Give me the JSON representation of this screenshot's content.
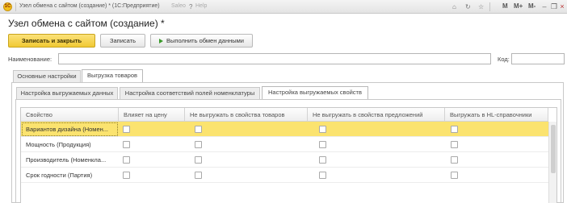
{
  "window": {
    "app_icon": "1С",
    "title": "Узел обмена с сайтом (создание) * (1С:Предприятие)",
    "grey_text": "Saleo",
    "help_text": "Help",
    "m_buttons": [
      "M",
      "M+",
      "M-"
    ],
    "icons": [
      "home-icon",
      "refresh-icon",
      "star-icon",
      "minimize-icon",
      "restore-icon",
      "close-icon"
    ]
  },
  "form": {
    "title": "Узел обмена с сайтом (создание) *"
  },
  "toolbar": {
    "save_close": "Записать и закрыть",
    "save": "Записать",
    "run_exchange": "Выполнить обмен данными"
  },
  "fields": {
    "name_label": "Наименование:",
    "name_value": "",
    "code_label": "Код:",
    "code_value": ""
  },
  "tabs": [
    {
      "label": "Основные настройки",
      "active": false
    },
    {
      "label": "Выгрузка товаров",
      "active": true
    }
  ],
  "subtabs": [
    {
      "label": "Настройка выгружаемых данных",
      "active": false
    },
    {
      "label": "Настройка соответствий полей номенклатуры",
      "active": false
    },
    {
      "label": "Настройка выгружаемых свойств",
      "active": true
    }
  ],
  "table": {
    "columns": [
      "Свойство",
      "Влияет на цену",
      "Не выгружать в свойства товаров",
      "Не выгружать в свойства предложений",
      "Выгружать в HL-справочники"
    ],
    "rows": [
      {
        "name": "Вариантов дизайна (Номен...",
        "checks": [
          false,
          false,
          false,
          false
        ],
        "selected": true
      },
      {
        "name": "Мощность (Продукция)",
        "checks": [
          false,
          false,
          false,
          false
        ],
        "selected": false
      },
      {
        "name": "Производитель (Номенкла...",
        "checks": [
          false,
          false,
          false,
          false
        ],
        "selected": false
      },
      {
        "name": "Срок годности (Партия)",
        "checks": [
          false,
          false,
          false,
          false
        ],
        "selected": false
      }
    ]
  },
  "colors": {
    "accent_yellow": "#f1c934",
    "selected_row": "#fbe36f"
  }
}
